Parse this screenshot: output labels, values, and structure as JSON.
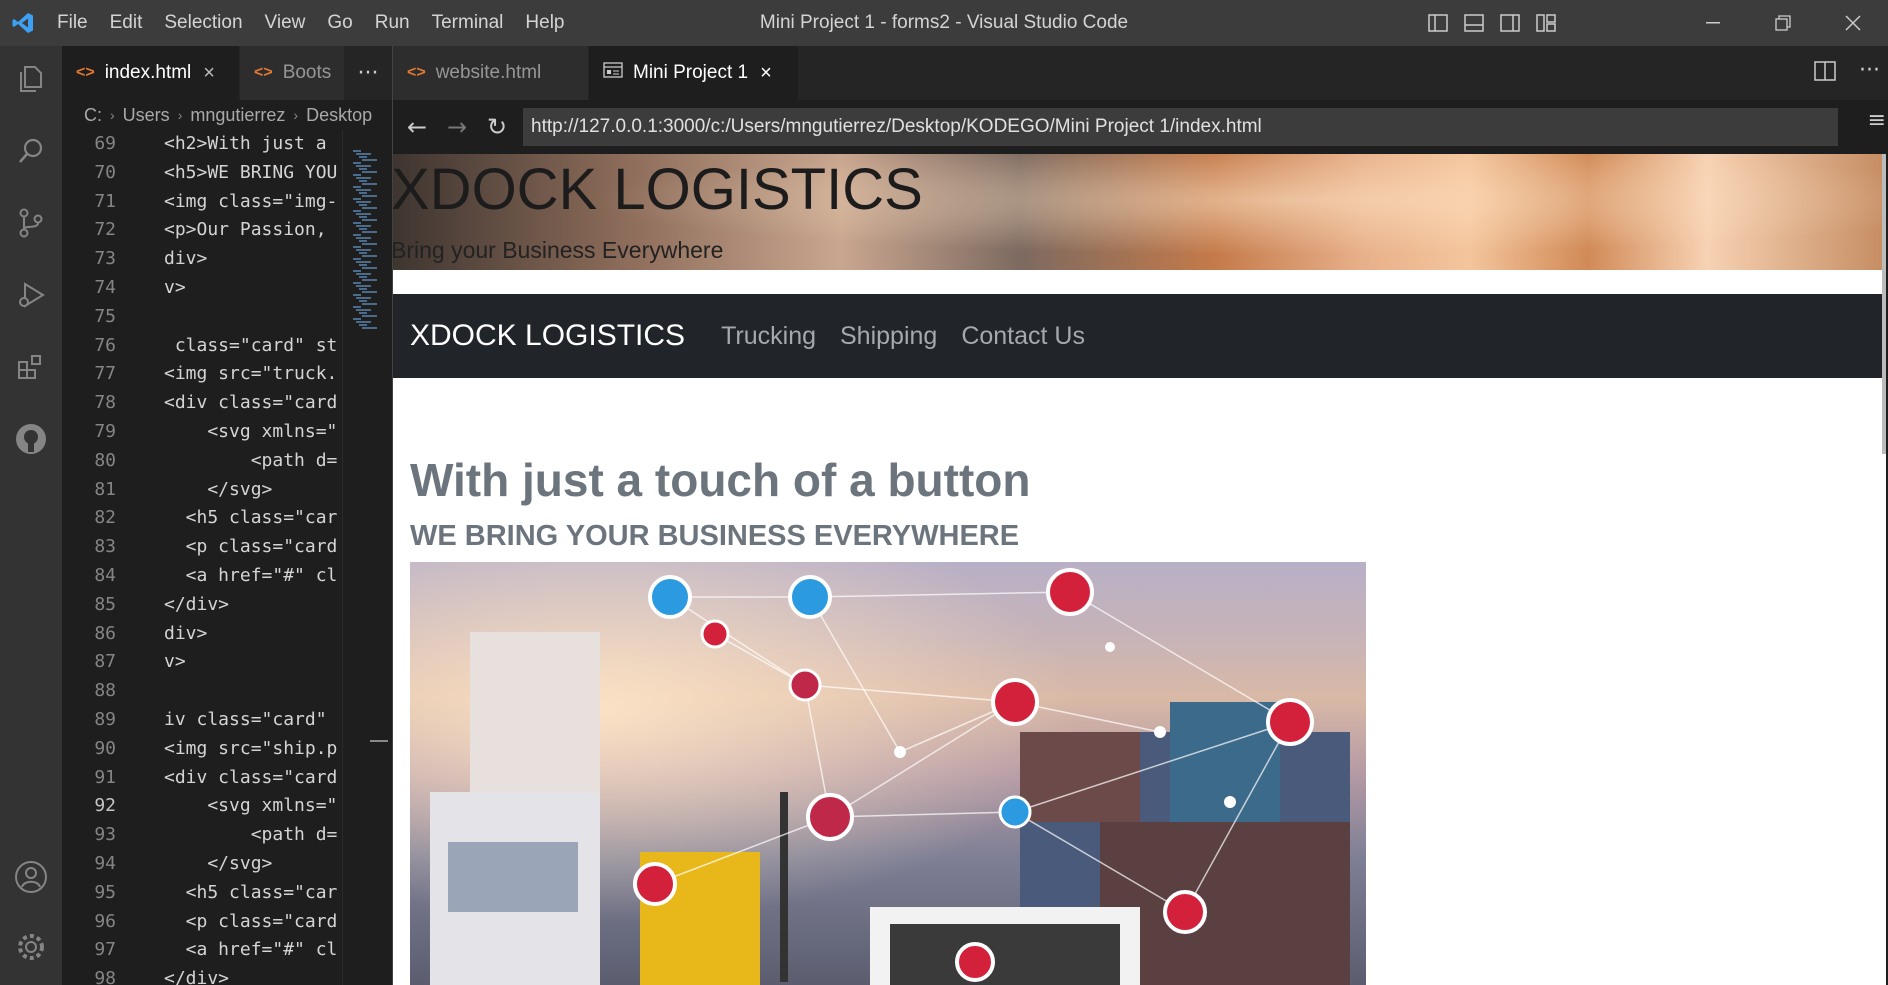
{
  "menu": {
    "items": [
      "File",
      "Edit",
      "Selection",
      "View",
      "Go",
      "Run",
      "Terminal",
      "Help"
    ]
  },
  "window": {
    "title": "Mini Project 1 - forms2 - Visual Studio Code"
  },
  "left_editor": {
    "tabs": [
      {
        "label": "index.html",
        "active": true
      },
      {
        "label": "Boots",
        "active": false
      }
    ],
    "breadcrumb": [
      "C:",
      "Users",
      "mngutierrez",
      "Desktop"
    ],
    "current_line": 92,
    "lines": [
      {
        "num": "69",
        "text": "<h2>With just a"
      },
      {
        "num": "70",
        "text": "<h5>WE BRING YOU"
      },
      {
        "num": "71",
        "text": "<img class=\"img-"
      },
      {
        "num": "72",
        "text": "<p>Our Passion,"
      },
      {
        "num": "73",
        "text": "div>"
      },
      {
        "num": "74",
        "text": "v>"
      },
      {
        "num": "75",
        "text": ""
      },
      {
        "num": "76",
        "text": " class=\"card\" st"
      },
      {
        "num": "77",
        "text": "<img src=\"truck."
      },
      {
        "num": "78",
        "text": "<div class=\"card"
      },
      {
        "num": "79",
        "text": "    <svg xmlns=\""
      },
      {
        "num": "80",
        "text": "        <path d="
      },
      {
        "num": "81",
        "text": "    </svg>"
      },
      {
        "num": "82",
        "text": "  <h5 class=\"car"
      },
      {
        "num": "83",
        "text": "  <p class=\"card"
      },
      {
        "num": "84",
        "text": "  <a href=\"#\" cl"
      },
      {
        "num": "85",
        "text": "</div>"
      },
      {
        "num": "86",
        "text": "div>"
      },
      {
        "num": "87",
        "text": "v>"
      },
      {
        "num": "88",
        "text": ""
      },
      {
        "num": "89",
        "text": "iv class=\"card\""
      },
      {
        "num": "90",
        "text": "<img src=\"ship.p"
      },
      {
        "num": "91",
        "text": "<div class=\"card"
      },
      {
        "num": "92",
        "text": "    <svg xmlns=\""
      },
      {
        "num": "93",
        "text": "        <path d="
      },
      {
        "num": "94",
        "text": "    </svg>"
      },
      {
        "num": "95",
        "text": "  <h5 class=\"car"
      },
      {
        "num": "96",
        "text": "  <p class=\"card"
      },
      {
        "num": "97",
        "text": "  <a href=\"#\" cl"
      },
      {
        "num": "98",
        "text": "</div>"
      }
    ]
  },
  "right_editor": {
    "tabs": [
      {
        "label": "website.html",
        "active": false
      },
      {
        "label": "Mini Project 1",
        "active": true
      }
    ],
    "browser": {
      "url": "http://127.0.0.1:3000/c:/Users/mngutierrez/Desktop/KODEGO/Mini Project 1/index.html"
    }
  },
  "website": {
    "hero_title": "XDOCK LOGISTICS",
    "hero_tagline": "Bring your Business Everywhere",
    "brand": "XDOCK LOGISTICS",
    "nav_links": [
      "Trucking",
      "Shipping",
      "Contact Us"
    ],
    "heading": "With just a touch of a button",
    "subheading": "WE BRING YOUR BUSINESS EVERYWHERE"
  },
  "colors": {
    "titlebar": "#3c3c3c",
    "activitybar": "#333333",
    "editor_bg": "#1e1e1e",
    "navbar_bg": "#212529",
    "heading_gray": "#6c757d",
    "vscode_blue": "#3ea0f4"
  },
  "icons": {
    "activity": [
      "files-icon",
      "search-icon",
      "source-control-icon",
      "run-debug-icon",
      "extensions-icon",
      "github-icon",
      "account-icon",
      "settings-gear-icon"
    ]
  }
}
